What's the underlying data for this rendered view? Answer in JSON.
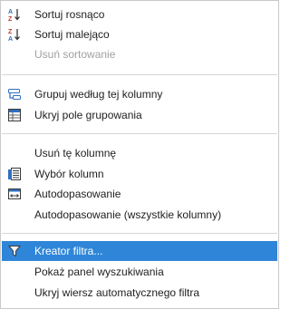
{
  "menu": {
    "items": [
      {
        "label": "Sortuj rosnąco",
        "icon": "sort-ascending-icon"
      },
      {
        "label": "Sortuj malejąco",
        "icon": "sort-descending-icon"
      },
      {
        "label": "Usuń sortowanie",
        "icon": "",
        "disabled": true
      },
      {
        "label": "Grupuj według tej kolumny",
        "icon": "group-by-column-icon"
      },
      {
        "label": "Ukryj pole grupowania",
        "icon": "group-panel-icon"
      },
      {
        "label": "Usuń tę kolumnę",
        "icon": ""
      },
      {
        "label": "Wybór kolumn",
        "icon": "column-chooser-icon"
      },
      {
        "label": "Autodopasowanie",
        "icon": "autofit-icon"
      },
      {
        "label": "Autodopasowanie (wszystkie kolumny)",
        "icon": ""
      },
      {
        "label": "Kreator filtra...",
        "icon": "filter-icon",
        "highlighted": true
      },
      {
        "label": "Pokaż panel wyszukiwania",
        "icon": ""
      },
      {
        "label": "Ukryj wiersz automatycznego filtra",
        "icon": ""
      }
    ]
  },
  "colors": {
    "highlight": "#2f86d8",
    "separator": "#d6d6d6",
    "disabled_text": "#a0a0a0"
  }
}
